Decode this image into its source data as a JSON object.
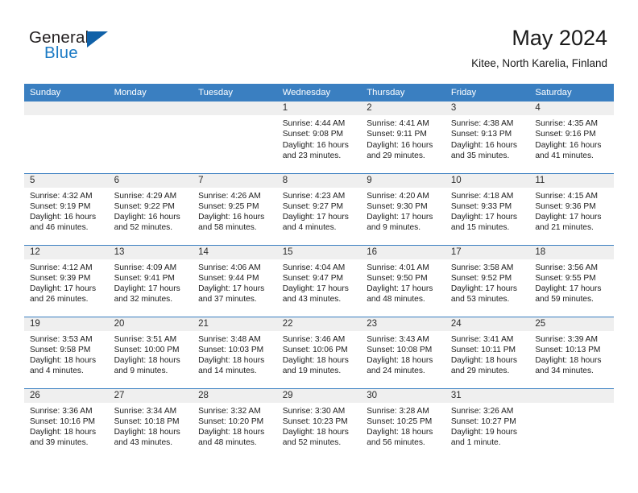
{
  "brand": {
    "name_part1": "General",
    "name_part2": "Blue",
    "accent_color": "#1b7ac4",
    "triangle_color": "#1061a8"
  },
  "header": {
    "title": "May 2024",
    "location": "Kitee, North Karelia, Finland"
  },
  "theme": {
    "header_blue": "#3a7fc1",
    "daynum_band": "#efefef",
    "text": "#1c1c1c"
  },
  "weekday_headers": [
    "Sunday",
    "Monday",
    "Tuesday",
    "Wednesday",
    "Thursday",
    "Friday",
    "Saturday"
  ],
  "weeks": [
    [
      {
        "day": "",
        "sunrise": "",
        "sunset": "",
        "daylight_line1": "",
        "daylight_line2": ""
      },
      {
        "day": "",
        "sunrise": "",
        "sunset": "",
        "daylight_line1": "",
        "daylight_line2": ""
      },
      {
        "day": "",
        "sunrise": "",
        "sunset": "",
        "daylight_line1": "",
        "daylight_line2": ""
      },
      {
        "day": "1",
        "sunrise": "Sunrise: 4:44 AM",
        "sunset": "Sunset: 9:08 PM",
        "daylight_line1": "Daylight: 16 hours",
        "daylight_line2": "and 23 minutes."
      },
      {
        "day": "2",
        "sunrise": "Sunrise: 4:41 AM",
        "sunset": "Sunset: 9:11 PM",
        "daylight_line1": "Daylight: 16 hours",
        "daylight_line2": "and 29 minutes."
      },
      {
        "day": "3",
        "sunrise": "Sunrise: 4:38 AM",
        "sunset": "Sunset: 9:13 PM",
        "daylight_line1": "Daylight: 16 hours",
        "daylight_line2": "and 35 minutes."
      },
      {
        "day": "4",
        "sunrise": "Sunrise: 4:35 AM",
        "sunset": "Sunset: 9:16 PM",
        "daylight_line1": "Daylight: 16 hours",
        "daylight_line2": "and 41 minutes."
      }
    ],
    [
      {
        "day": "5",
        "sunrise": "Sunrise: 4:32 AM",
        "sunset": "Sunset: 9:19 PM",
        "daylight_line1": "Daylight: 16 hours",
        "daylight_line2": "and 46 minutes."
      },
      {
        "day": "6",
        "sunrise": "Sunrise: 4:29 AM",
        "sunset": "Sunset: 9:22 PM",
        "daylight_line1": "Daylight: 16 hours",
        "daylight_line2": "and 52 minutes."
      },
      {
        "day": "7",
        "sunrise": "Sunrise: 4:26 AM",
        "sunset": "Sunset: 9:25 PM",
        "daylight_line1": "Daylight: 16 hours",
        "daylight_line2": "and 58 minutes."
      },
      {
        "day": "8",
        "sunrise": "Sunrise: 4:23 AM",
        "sunset": "Sunset: 9:27 PM",
        "daylight_line1": "Daylight: 17 hours",
        "daylight_line2": "and 4 minutes."
      },
      {
        "day": "9",
        "sunrise": "Sunrise: 4:20 AM",
        "sunset": "Sunset: 9:30 PM",
        "daylight_line1": "Daylight: 17 hours",
        "daylight_line2": "and 9 minutes."
      },
      {
        "day": "10",
        "sunrise": "Sunrise: 4:18 AM",
        "sunset": "Sunset: 9:33 PM",
        "daylight_line1": "Daylight: 17 hours",
        "daylight_line2": "and 15 minutes."
      },
      {
        "day": "11",
        "sunrise": "Sunrise: 4:15 AM",
        "sunset": "Sunset: 9:36 PM",
        "daylight_line1": "Daylight: 17 hours",
        "daylight_line2": "and 21 minutes."
      }
    ],
    [
      {
        "day": "12",
        "sunrise": "Sunrise: 4:12 AM",
        "sunset": "Sunset: 9:39 PM",
        "daylight_line1": "Daylight: 17 hours",
        "daylight_line2": "and 26 minutes."
      },
      {
        "day": "13",
        "sunrise": "Sunrise: 4:09 AM",
        "sunset": "Sunset: 9:41 PM",
        "daylight_line1": "Daylight: 17 hours",
        "daylight_line2": "and 32 minutes."
      },
      {
        "day": "14",
        "sunrise": "Sunrise: 4:06 AM",
        "sunset": "Sunset: 9:44 PM",
        "daylight_line1": "Daylight: 17 hours",
        "daylight_line2": "and 37 minutes."
      },
      {
        "day": "15",
        "sunrise": "Sunrise: 4:04 AM",
        "sunset": "Sunset: 9:47 PM",
        "daylight_line1": "Daylight: 17 hours",
        "daylight_line2": "and 43 minutes."
      },
      {
        "day": "16",
        "sunrise": "Sunrise: 4:01 AM",
        "sunset": "Sunset: 9:50 PM",
        "daylight_line1": "Daylight: 17 hours",
        "daylight_line2": "and 48 minutes."
      },
      {
        "day": "17",
        "sunrise": "Sunrise: 3:58 AM",
        "sunset": "Sunset: 9:52 PM",
        "daylight_line1": "Daylight: 17 hours",
        "daylight_line2": "and 53 minutes."
      },
      {
        "day": "18",
        "sunrise": "Sunrise: 3:56 AM",
        "sunset": "Sunset: 9:55 PM",
        "daylight_line1": "Daylight: 17 hours",
        "daylight_line2": "and 59 minutes."
      }
    ],
    [
      {
        "day": "19",
        "sunrise": "Sunrise: 3:53 AM",
        "sunset": "Sunset: 9:58 PM",
        "daylight_line1": "Daylight: 18 hours",
        "daylight_line2": "and 4 minutes."
      },
      {
        "day": "20",
        "sunrise": "Sunrise: 3:51 AM",
        "sunset": "Sunset: 10:00 PM",
        "daylight_line1": "Daylight: 18 hours",
        "daylight_line2": "and 9 minutes."
      },
      {
        "day": "21",
        "sunrise": "Sunrise: 3:48 AM",
        "sunset": "Sunset: 10:03 PM",
        "daylight_line1": "Daylight: 18 hours",
        "daylight_line2": "and 14 minutes."
      },
      {
        "day": "22",
        "sunrise": "Sunrise: 3:46 AM",
        "sunset": "Sunset: 10:06 PM",
        "daylight_line1": "Daylight: 18 hours",
        "daylight_line2": "and 19 minutes."
      },
      {
        "day": "23",
        "sunrise": "Sunrise: 3:43 AM",
        "sunset": "Sunset: 10:08 PM",
        "daylight_line1": "Daylight: 18 hours",
        "daylight_line2": "and 24 minutes."
      },
      {
        "day": "24",
        "sunrise": "Sunrise: 3:41 AM",
        "sunset": "Sunset: 10:11 PM",
        "daylight_line1": "Daylight: 18 hours",
        "daylight_line2": "and 29 minutes."
      },
      {
        "day": "25",
        "sunrise": "Sunrise: 3:39 AM",
        "sunset": "Sunset: 10:13 PM",
        "daylight_line1": "Daylight: 18 hours",
        "daylight_line2": "and 34 minutes."
      }
    ],
    [
      {
        "day": "26",
        "sunrise": "Sunrise: 3:36 AM",
        "sunset": "Sunset: 10:16 PM",
        "daylight_line1": "Daylight: 18 hours",
        "daylight_line2": "and 39 minutes."
      },
      {
        "day": "27",
        "sunrise": "Sunrise: 3:34 AM",
        "sunset": "Sunset: 10:18 PM",
        "daylight_line1": "Daylight: 18 hours",
        "daylight_line2": "and 43 minutes."
      },
      {
        "day": "28",
        "sunrise": "Sunrise: 3:32 AM",
        "sunset": "Sunset: 10:20 PM",
        "daylight_line1": "Daylight: 18 hours",
        "daylight_line2": "and 48 minutes."
      },
      {
        "day": "29",
        "sunrise": "Sunrise: 3:30 AM",
        "sunset": "Sunset: 10:23 PM",
        "daylight_line1": "Daylight: 18 hours",
        "daylight_line2": "and 52 minutes."
      },
      {
        "day": "30",
        "sunrise": "Sunrise: 3:28 AM",
        "sunset": "Sunset: 10:25 PM",
        "daylight_line1": "Daylight: 18 hours",
        "daylight_line2": "and 56 minutes."
      },
      {
        "day": "31",
        "sunrise": "Sunrise: 3:26 AM",
        "sunset": "Sunset: 10:27 PM",
        "daylight_line1": "Daylight: 19 hours",
        "daylight_line2": "and 1 minute."
      },
      {
        "day": "",
        "sunrise": "",
        "sunset": "",
        "daylight_line1": "",
        "daylight_line2": ""
      }
    ]
  ]
}
